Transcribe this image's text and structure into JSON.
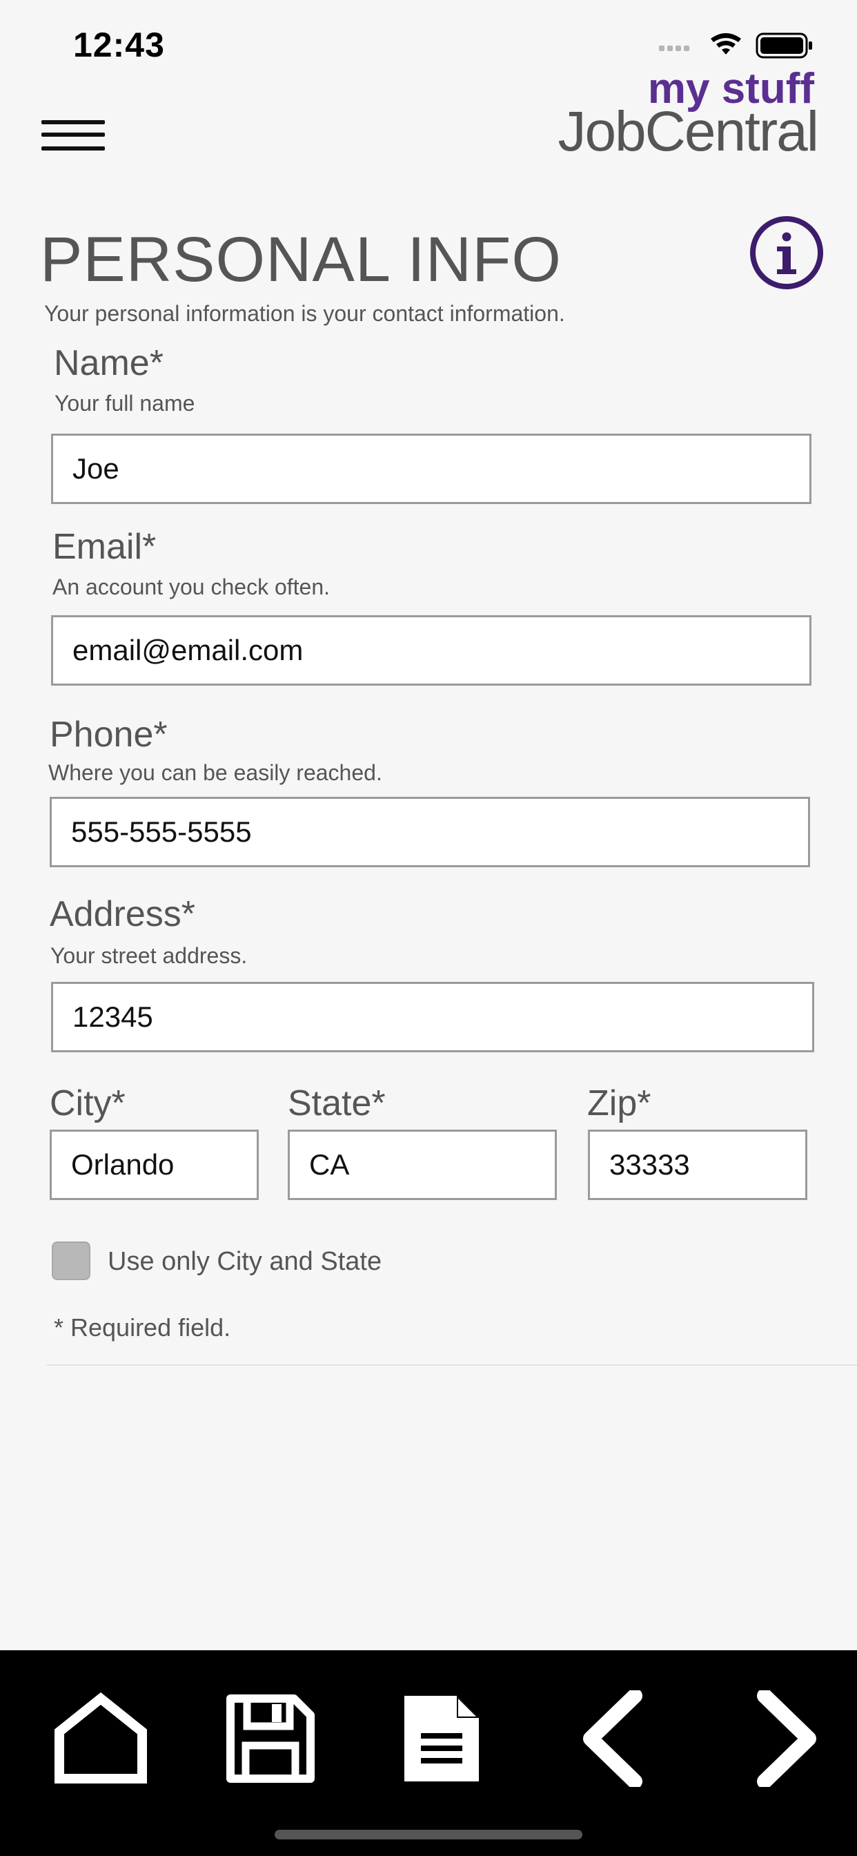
{
  "status_bar": {
    "time": "12:43"
  },
  "header": {
    "brand_top": "my stuff",
    "brand_bottom": "JobCentral",
    "brand_color": "#5b2f91"
  },
  "page": {
    "title": "PERSONAL INFO",
    "subtitle": "Your personal information is your contact information."
  },
  "form": {
    "name": {
      "label": "Name*",
      "hint": "Your full name",
      "value": "Joe"
    },
    "email": {
      "label": "Email*",
      "hint": "An account you check often.",
      "value": "email@email.com"
    },
    "phone": {
      "label": "Phone*",
      "hint": "Where you can be easily reached.",
      "value": "555-555-5555"
    },
    "address": {
      "label": "Address*",
      "hint": "Your street address.",
      "value": "12345"
    },
    "city": {
      "label": "City*",
      "value": "Orlando"
    },
    "state": {
      "label": "State*",
      "value": "CA"
    },
    "zip": {
      "label": "Zip*",
      "value": "33333"
    },
    "use_city_state": {
      "label": "Use only City and State",
      "checked": false
    },
    "required_note": "* Required field."
  },
  "bottom_nav": {
    "icons": [
      "home-icon",
      "save-icon",
      "document-icon",
      "chevron-left-icon",
      "chevron-right-icon"
    ]
  }
}
